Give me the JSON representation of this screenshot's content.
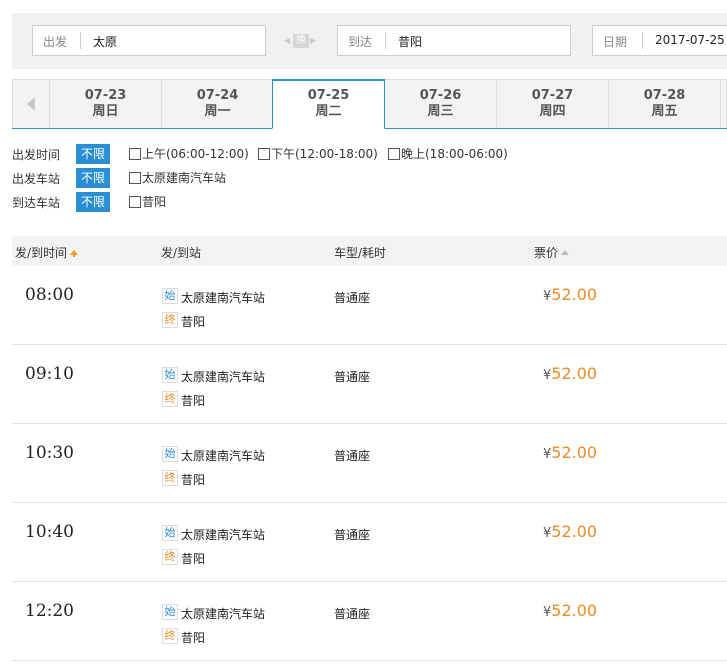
{
  "search": {
    "from_label": "出发",
    "from_value": "太原",
    "swap_label": "换",
    "to_label": "到达",
    "to_value": "昔阳",
    "date_label": "日期",
    "date_value": "2017-07-25"
  },
  "dates": [
    {
      "date": "07-23",
      "weekday": "周日"
    },
    {
      "date": "07-24",
      "weekday": "周一"
    },
    {
      "date": "07-25",
      "weekday": "周二"
    },
    {
      "date": "07-26",
      "weekday": "周三"
    },
    {
      "date": "07-27",
      "weekday": "周四"
    },
    {
      "date": "07-28",
      "weekday": "周五"
    }
  ],
  "filters": {
    "depart_time": {
      "title": "出发时间",
      "all": "不限",
      "options": [
        "上午(06:00-12:00)",
        "下午(12:00-18:00)",
        "晚上(18:00-06:00)"
      ]
    },
    "depart_station": {
      "title": "出发车站",
      "all": "不限",
      "options": [
        "太原建南汽车站"
      ]
    },
    "arrive_station": {
      "title": "到达车站",
      "all": "不限",
      "options": [
        "昔阳"
      ]
    }
  },
  "table": {
    "headers": {
      "time": "发/到时间",
      "stations": "发/到站",
      "type": "车型/耗时",
      "price": "票价"
    },
    "start_badge": "始",
    "end_badge": "终",
    "currency": "¥",
    "rows": [
      {
        "time": "08:00",
        "from": "太原建南汽车站",
        "to": "昔阳",
        "seat": "普通座",
        "price": "52.00"
      },
      {
        "time": "09:10",
        "from": "太原建南汽车站",
        "to": "昔阳",
        "seat": "普通座",
        "price": "52.00"
      },
      {
        "time": "10:30",
        "from": "太原建南汽车站",
        "to": "昔阳",
        "seat": "普通座",
        "price": "52.00"
      },
      {
        "time": "10:40",
        "from": "太原建南汽车站",
        "to": "昔阳",
        "seat": "普通座",
        "price": "52.00"
      },
      {
        "time": "12:20",
        "from": "太原建南汽车站",
        "to": "昔阳",
        "seat": "普通座",
        "price": "52.00"
      }
    ]
  },
  "colors": {
    "accent": "#2b8fd6",
    "price": "#f08a24"
  }
}
